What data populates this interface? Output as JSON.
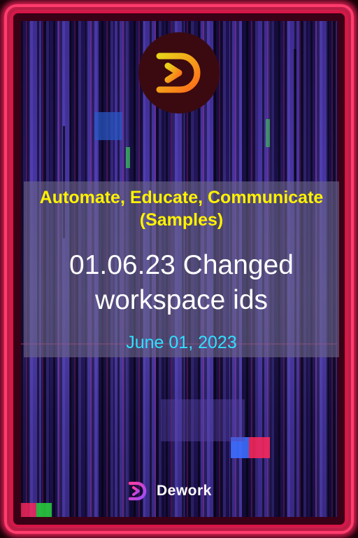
{
  "card": {
    "tagline": "Automate, Educate, Communicate (Samples)",
    "title": "01.06.23 Changed workspace ids",
    "date": "June 01, 2023"
  },
  "brand": {
    "name": "Dework",
    "logo_icon": "dework-logo-icon"
  },
  "colors": {
    "frame": "#ff3d6e",
    "tagline": "#fff200",
    "title": "#ffffff",
    "date": "#2fe0ff",
    "background": "#3b2a8a"
  }
}
